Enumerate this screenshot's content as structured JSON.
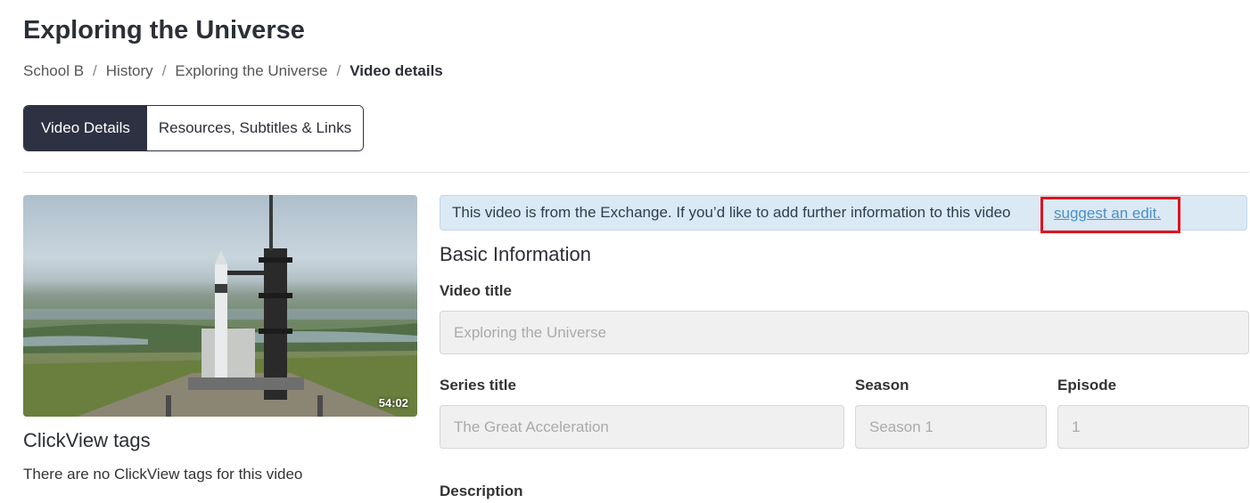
{
  "header": {
    "title": "Exploring the Universe",
    "breadcrumb": [
      "School B",
      "History",
      "Exploring the Universe"
    ],
    "breadcrumb_separator": "/",
    "breadcrumb_current": "Video details"
  },
  "tabs": [
    {
      "label": "Video Details",
      "active": true
    },
    {
      "label": "Resources, Subtitles & Links",
      "active": false
    }
  ],
  "video": {
    "duration": "54:02",
    "thumbnail": "rocket-launch-pad-image"
  },
  "tags": {
    "heading": "ClickView tags",
    "empty_text": "There are no ClickView tags for this video"
  },
  "alert": {
    "text": "This video is from the Exchange. If you’d like to add further information to this video",
    "link": "suggest an edit."
  },
  "basic_info": {
    "heading": "Basic Information",
    "video_title_label": "Video title",
    "video_title_value": "Exploring the Universe",
    "series_title_label": "Series title",
    "series_title_value": "The Great Acceleration",
    "season_label": "Season",
    "season_value": "Season 1",
    "episode_label": "Episode",
    "episode_value": "1",
    "description_label": "Description"
  },
  "colors": {
    "primary_dark": "#2d3142",
    "alert_bg": "#dbe9f5",
    "link": "#4a90c6",
    "highlight": "#e0141e"
  }
}
